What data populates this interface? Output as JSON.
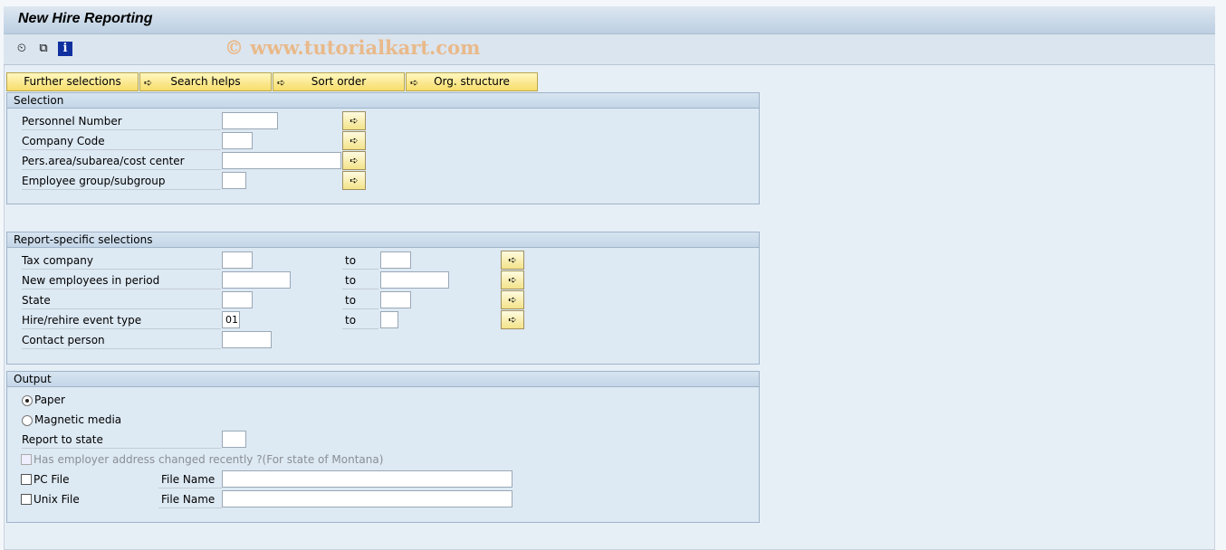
{
  "title": "New Hire Reporting",
  "toolbar": {
    "icons": [
      "execute-icon",
      "variants-icon",
      "info-icon"
    ]
  },
  "watermark": "© www.tutorialkart.com",
  "tabs": [
    "Further selections",
    "Search helps",
    "Sort order",
    "Org. structure"
  ],
  "selection": {
    "title": "Selection",
    "rows": [
      {
        "label": "Personnel Number",
        "value": ""
      },
      {
        "label": "Company Code",
        "value": ""
      },
      {
        "label": "Pers.area/subarea/cost center",
        "value": ""
      },
      {
        "label": "Employee group/subgroup",
        "value": ""
      }
    ]
  },
  "report": {
    "title": "Report-specific selections",
    "to": "to",
    "rows": [
      {
        "label": "Tax company",
        "from": "",
        "to": ""
      },
      {
        "label": "New employees in period",
        "from": "",
        "to": ""
      },
      {
        "label": "State",
        "from": "",
        "to": ""
      },
      {
        "label": "Hire/rehire event type",
        "from": "01",
        "to": ""
      },
      {
        "label": "Contact person",
        "from": ""
      }
    ]
  },
  "output": {
    "title": "Output",
    "paper": {
      "label": "Paper",
      "selected": true
    },
    "magnetic": {
      "label": "Magnetic media",
      "selected": false
    },
    "report_to_state": {
      "label": "Report to state",
      "value": ""
    },
    "employer_changed": {
      "label": "Has employer address changed recently ?(For state of Montana)",
      "checked": false,
      "disabled": true
    },
    "pc_file": {
      "label": "PC File",
      "checked": false,
      "file_label": "File Name",
      "file_value": ""
    },
    "unix_file": {
      "label": "Unix File",
      "checked": false,
      "file_label": "File Name",
      "file_value": ""
    }
  }
}
